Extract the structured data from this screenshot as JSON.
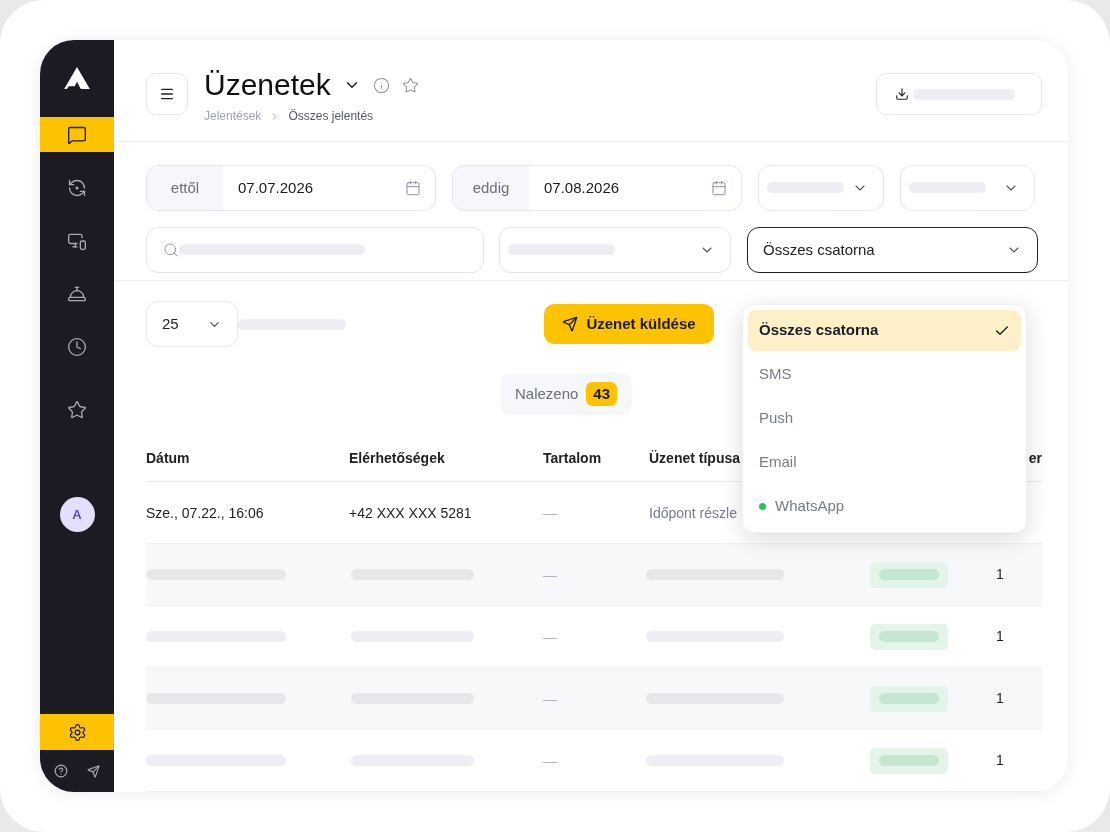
{
  "sidebar": {
    "items": [
      {
        "kind": "chat",
        "selected": true
      },
      {
        "kind": "cycle",
        "selected": false
      },
      {
        "kind": "screen",
        "selected": false
      },
      {
        "kind": "bell",
        "selected": false
      },
      {
        "kind": "clock",
        "selected": false
      },
      {
        "kind": "star",
        "selected": false
      }
    ],
    "avatar": "A",
    "settings": {
      "selected": true
    }
  },
  "header": {
    "title": "Üzenetek",
    "breadcrumb": [
      "Jelentések",
      "Összes jelentés"
    ]
  },
  "filters": {
    "date_from": {
      "label": "ettől",
      "value": "07.07.2026"
    },
    "date_to": {
      "label": "eddig",
      "value": "07.08.2026"
    },
    "channel": {
      "value": "Összes csatorna",
      "open": true
    }
  },
  "toolbar": {
    "page_size": "25",
    "send_button": "Üzenet küldése",
    "found": {
      "label": "Nalezeno",
      "count": "43"
    }
  },
  "table": {
    "columns": [
      "Dátum",
      "Elérhetőségek",
      "Tartalom",
      "Üzenet típusa",
      "er"
    ],
    "rows": [
      {
        "kind": "data",
        "cells": [
          "Sze., 07.22., 16:06",
          "+42 XXX XXX 5281",
          "—",
          "Időpont részle"
        ]
      },
      {
        "kind": "skeleton",
        "content": "—",
        "count": "1"
      },
      {
        "kind": "skeleton",
        "content": "—",
        "count": "1"
      },
      {
        "kind": "skeleton",
        "content": "—",
        "count": "1"
      },
      {
        "kind": "skeleton",
        "content": "—",
        "count": "1"
      }
    ]
  },
  "channel_menu": {
    "options": [
      {
        "label": "Összes csatorna",
        "selected": true
      },
      {
        "label": "SMS",
        "selected": false
      },
      {
        "label": "Push",
        "selected": false
      },
      {
        "label": "Email",
        "selected": false
      },
      {
        "label": "WhatsApp",
        "selected": false,
        "color": "#22c55e"
      }
    ]
  }
}
